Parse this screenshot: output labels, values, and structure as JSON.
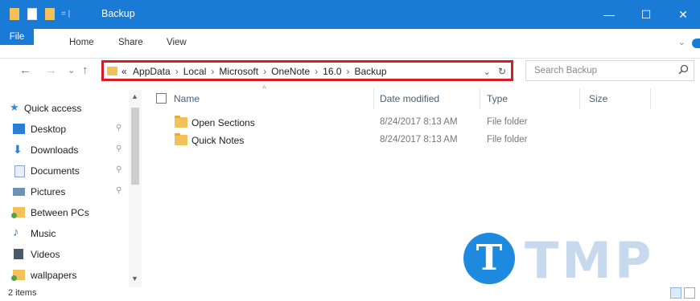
{
  "window": {
    "title": "Backup",
    "controls": {
      "minimize": "—",
      "maximize": "☐",
      "close": "✕"
    }
  },
  "ribbon": {
    "tabs": [
      "File",
      "Home",
      "Share",
      "View"
    ],
    "expand": "⌄"
  },
  "nav_buttons": {
    "back": "←",
    "forward": "→",
    "recent": "⌄",
    "up": "↑"
  },
  "address": {
    "overflow": "«",
    "crumbs": [
      "AppData",
      "Local",
      "Microsoft",
      "OneNote",
      "16.0",
      "Backup"
    ],
    "separator": "›",
    "dropdown": "⌄",
    "refresh": "↻"
  },
  "search": {
    "placeholder": "Search Backup",
    "icon": "search-icon"
  },
  "nav_pane": {
    "items": [
      {
        "label": "Quick access",
        "icon": "star-icon",
        "pinned": false
      },
      {
        "label": "Desktop",
        "icon": "desktop-icon",
        "pinned": true
      },
      {
        "label": "Downloads",
        "icon": "download-icon",
        "pinned": true
      },
      {
        "label": "Documents",
        "icon": "documents-icon",
        "pinned": true
      },
      {
        "label": "Pictures",
        "icon": "pictures-icon",
        "pinned": true
      },
      {
        "label": "Between PCs",
        "icon": "folder-sync-icon",
        "pinned": false
      },
      {
        "label": "Music",
        "icon": "music-icon",
        "pinned": false
      },
      {
        "label": "Videos",
        "icon": "videos-icon",
        "pinned": false
      },
      {
        "label": "wallpapers",
        "icon": "folder-sync-icon",
        "pinned": false
      }
    ],
    "pin_glyph": "⚲"
  },
  "file_list": {
    "columns": [
      "Name",
      "Date modified",
      "Type",
      "Size"
    ],
    "sort_glyph": "^",
    "rows": [
      {
        "name": "Open Sections",
        "date": "8/24/2017 8:13 AM",
        "type": "File folder"
      },
      {
        "name": "Quick Notes",
        "date": "8/24/2017 8:13 AM",
        "type": "File folder"
      }
    ]
  },
  "status": {
    "text": "2 items"
  },
  "watermark": {
    "circle_letter": "T",
    "text": "TMP"
  },
  "colors": {
    "accent": "#1a7bd6",
    "highlight_border": "#d41b26",
    "folder": "#f3c15a"
  }
}
